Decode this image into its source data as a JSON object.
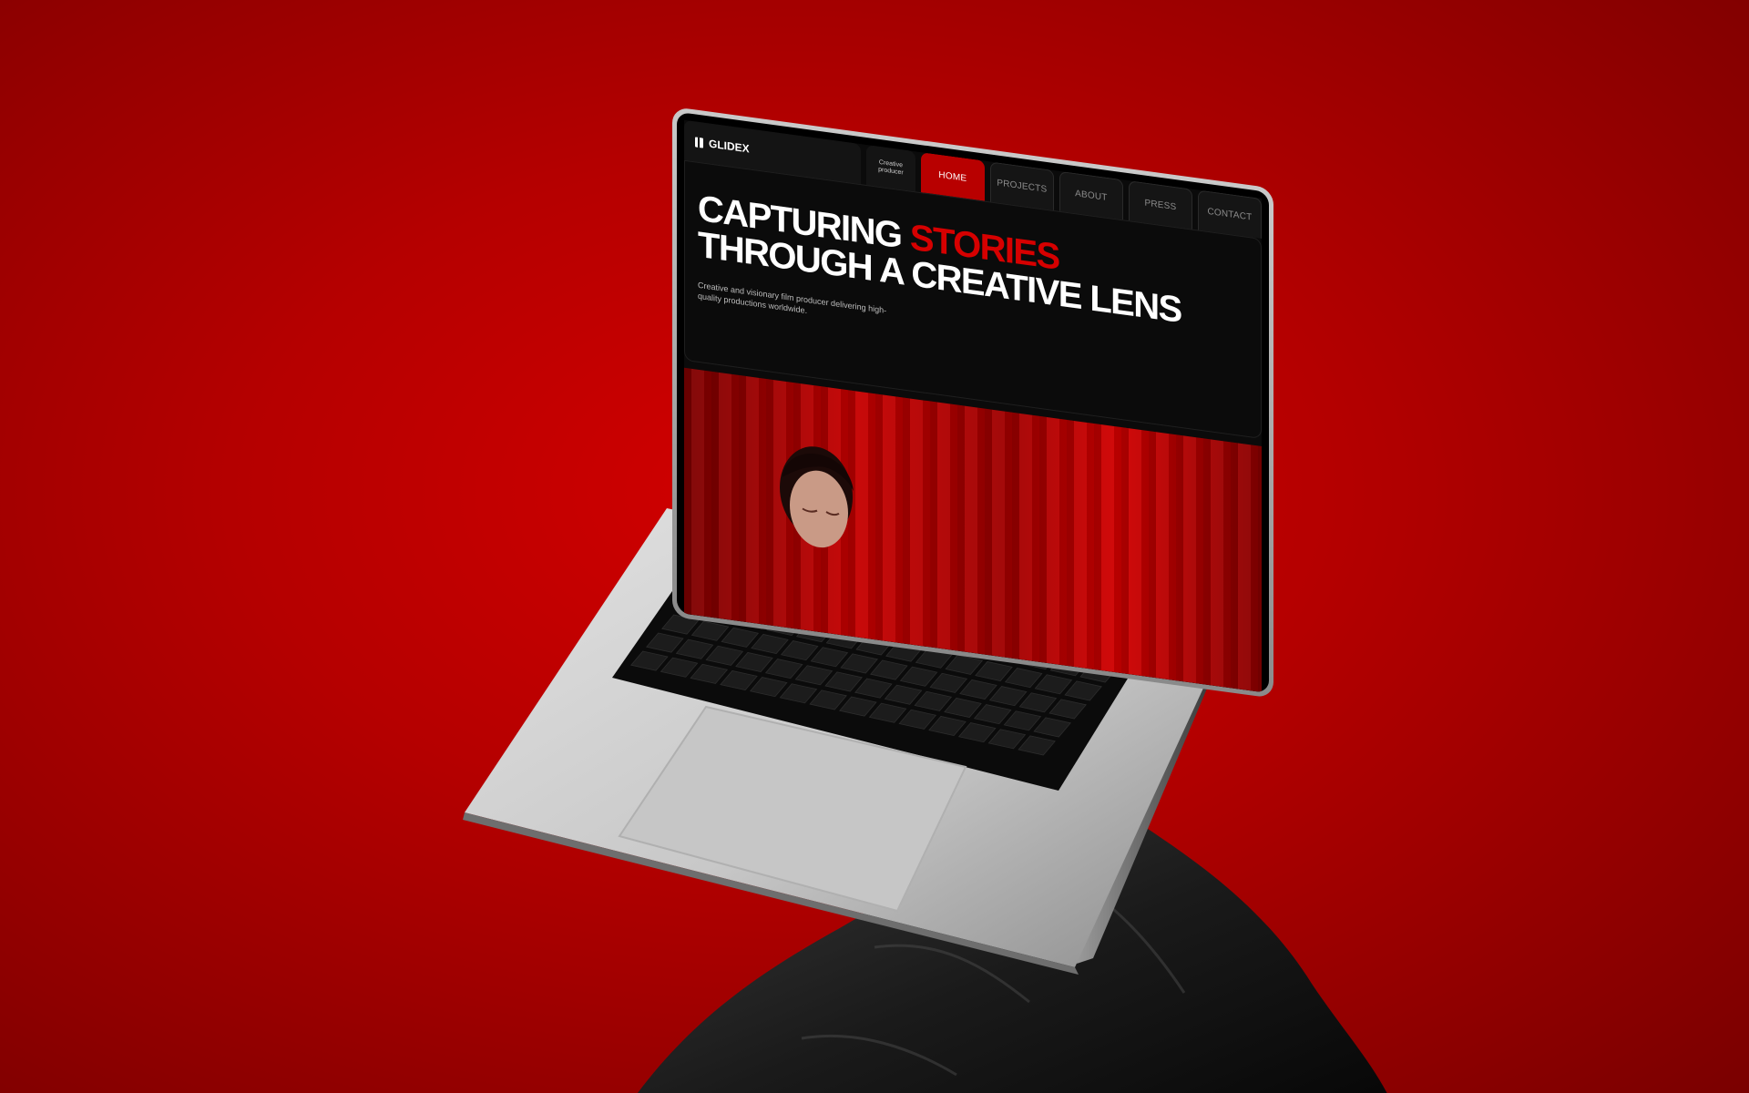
{
  "scene": {
    "background_color": "#c40000",
    "device": "laptop-mockup"
  },
  "site": {
    "logo_text": "GLIDEX",
    "tagline": "Creative producer",
    "nav": [
      {
        "label": "HOME",
        "active": true
      },
      {
        "label": "PROJECTS",
        "active": false
      },
      {
        "label": "ABOUT",
        "active": false
      },
      {
        "label": "PRESS",
        "active": false
      },
      {
        "label": "CONTACT",
        "active": false
      }
    ],
    "headline": {
      "part1": "CAPTURING ",
      "accent": "STORIES",
      "line2": "THROUGH A CREATIVE LENS"
    },
    "subtitle": "Creative and visionary film producer delivering high-quality productions worldwide.",
    "accent_color": "#d60000"
  }
}
